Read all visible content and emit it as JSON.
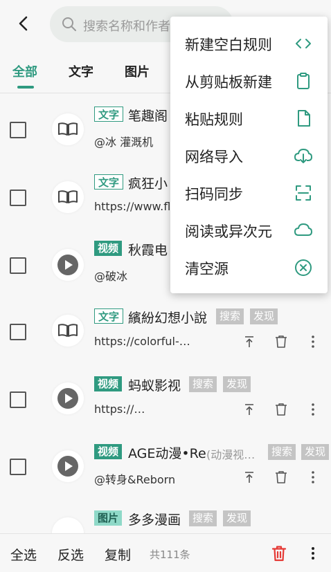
{
  "search": {
    "placeholder": "搜索名称和作者"
  },
  "tabs": [
    {
      "label": "全部",
      "active": true
    },
    {
      "label": "文字",
      "active": false
    },
    {
      "label": "图片",
      "active": false
    }
  ],
  "sources": [
    {
      "type": "文字",
      "name": "笔趣阁",
      "group": "",
      "tags": [],
      "subtitle": "@冰 灌溉机"
    },
    {
      "type": "文字",
      "name": "疯狂小",
      "group": "",
      "tags": [],
      "subtitle": "https://www.fl"
    },
    {
      "type": "视频",
      "name": "秋霞电",
      "group": "",
      "tags": [],
      "subtitle": "@破冰"
    },
    {
      "type": "文字",
      "name": "繽紛幻想小說",
      "group": "",
      "tags": [
        "搜索",
        "发现"
      ],
      "subtitle": "https://colorful-…"
    },
    {
      "type": "视频",
      "name": "蚂蚁影视",
      "group": "",
      "tags": [
        "搜索",
        "发现"
      ],
      "subtitle": "https://…"
    },
    {
      "type": "视频",
      "name": "AGE动漫•Re",
      "group": "(动漫视…",
      "tags": [
        "搜索",
        "发现"
      ],
      "subtitle": "@转身&Reborn"
    },
    {
      "type": "图片",
      "name": "多多漫画",
      "group": "",
      "tags": [
        "搜索",
        "发现"
      ],
      "subtitle": ""
    }
  ],
  "bottom": {
    "select_all": "全选",
    "invert": "反选",
    "copy": "复制",
    "count": "共111条"
  },
  "menu": {
    "items": [
      {
        "label": "新建空白规则",
        "icon": "code-icon"
      },
      {
        "label": "从剪贴板新建",
        "icon": "clipboard-icon"
      },
      {
        "label": "粘贴规则",
        "icon": "file-icon"
      },
      {
        "label": "网络导入",
        "icon": "cloud-download-icon"
      },
      {
        "label": "扫码同步",
        "icon": "scan-icon"
      },
      {
        "label": "阅读或异次元",
        "icon": "cloud-icon"
      },
      {
        "label": "清空源",
        "icon": "clear-icon"
      }
    ]
  },
  "colors": {
    "accent": "#2f9a80",
    "tag_bg": "#c4c4c4",
    "delete": "#e53935"
  }
}
